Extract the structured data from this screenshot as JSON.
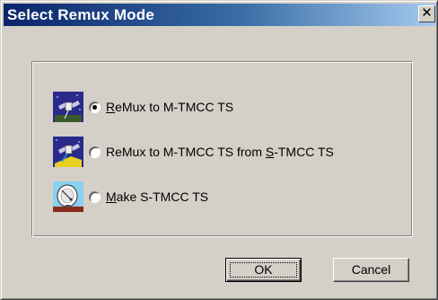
{
  "window": {
    "title": "Select Remux Mode",
    "close_glyph": "✕"
  },
  "options": [
    {
      "icon": "satellite-icon",
      "label_pre": "",
      "mnemonic": "R",
      "label_post": "eMux to M-TMCC TS",
      "selected": true
    },
    {
      "icon": "satellite-transmit-icon",
      "label_pre": "ReMux to M-TMCC TS from ",
      "mnemonic": "S",
      "label_post": "-TMCC TS",
      "selected": false
    },
    {
      "icon": "satellite-dish-icon",
      "label_pre": "",
      "mnemonic": "M",
      "label_post": "ake S-TMCC TS",
      "selected": false
    }
  ],
  "buttons": {
    "ok_label": "OK",
    "cancel_label": "Cancel"
  }
}
